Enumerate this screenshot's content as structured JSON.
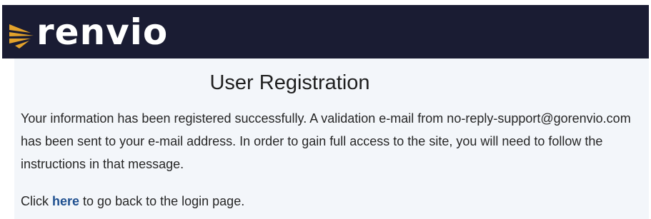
{
  "header": {
    "logo_text": "renvio",
    "brand_bg": "#1a1c33",
    "accent": "#e3a22b",
    "logo_icon": "sunburst-icon"
  },
  "page": {
    "title": "User Registration",
    "message": "Your information has been registered successfully. A validation e-mail from no-reply-support@gorenvio.com has been sent to your e-mail address. In order to gain full access to the site, you will need to follow the instructions in that message.",
    "back_prefix": "Click ",
    "back_link_label": "here",
    "back_suffix": " to go back to the login page."
  }
}
